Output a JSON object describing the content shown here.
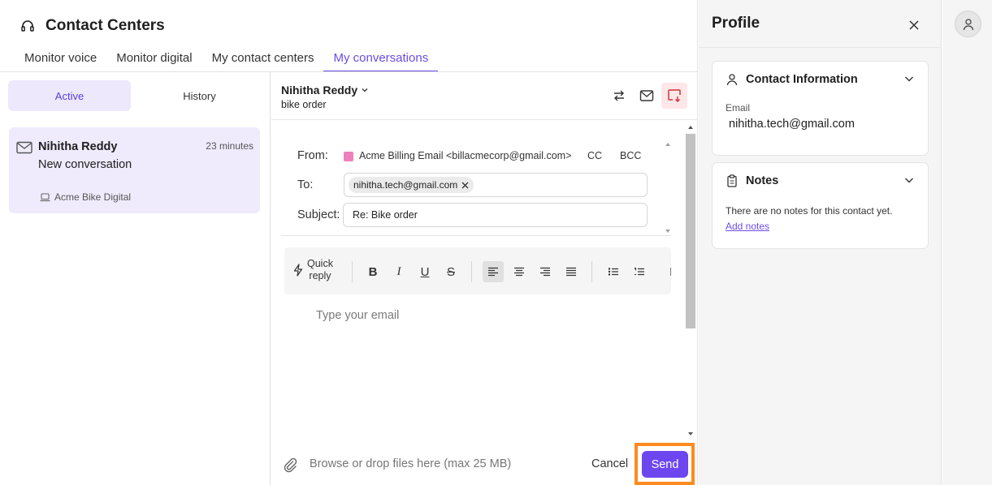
{
  "app": {
    "title": "Contact Centers",
    "icon": "headset-icon"
  },
  "tabs": [
    {
      "label": "Monitor voice",
      "active": false
    },
    {
      "label": "Monitor digital",
      "active": false
    },
    {
      "label": "My contact centers",
      "active": false
    },
    {
      "label": "My conversations",
      "active": true
    }
  ],
  "conversation_list": {
    "segments": {
      "active": "Active",
      "history": "History",
      "selected": "Active"
    },
    "items": [
      {
        "name": "Nihitha Reddy",
        "time": "23 minutes",
        "subtitle": "New conversation",
        "channel": "Acme Bike Digital",
        "icon": "mail-icon",
        "channel_icon": "laptop-icon"
      }
    ]
  },
  "conversation": {
    "contact_name": "Nihitha Reddy",
    "topic": "bike order",
    "actions": [
      "transfer-icon",
      "mail-icon",
      "end-conversation-icon"
    ],
    "email": {
      "from_label": "From:",
      "from_value": "Acme Billing Email <billacmecorp@gmail.com>",
      "from_color": "#ee7fbd",
      "cc_label": "CC",
      "bcc_label": "BCC",
      "to_label": "To:",
      "to_recipient": "nihitha.tech@gmail.com",
      "subject_label": "Subject:",
      "subject_value": "Re: Bike order",
      "body_placeholder": "Type your email"
    },
    "toolbar": {
      "quick_reply_line1": "Quick",
      "quick_reply_line2": "reply",
      "bold": "B",
      "italic": "I",
      "underline": "U",
      "strikethrough": "S",
      "align_selected": "left"
    },
    "footer": {
      "attach_text": "Browse or drop files here (max 25 MB)",
      "cancel_label": "Cancel",
      "send_label": "Send"
    }
  },
  "profile": {
    "title": "Profile",
    "contact_info": {
      "heading": "Contact Information",
      "email_label": "Email",
      "email_value": "nihitha.tech@gmail.com"
    },
    "notes": {
      "heading": "Notes",
      "empty_text": "There are no notes for this contact yet.",
      "add_link": "Add notes"
    }
  },
  "colors": {
    "accent": "#6b4ce6",
    "send_button": "#6d46f0",
    "highlight": "#ff8a1f",
    "end_button_bg": "#fde7e9",
    "end_button_icon": "#d13438"
  }
}
